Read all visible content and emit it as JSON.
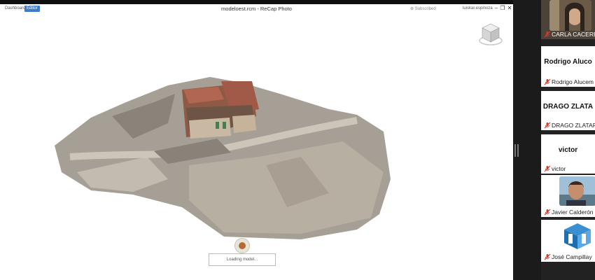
{
  "viewer": {
    "tabs": {
      "dashboard": "Dashboard",
      "editor": "Editor"
    },
    "title": "modeloest.rcm - ReCap Photo",
    "subscribed": "Subscribed",
    "user": "luiskar.espinoza",
    "loading": "Loading model..."
  },
  "participants": [
    {
      "display_name": "",
      "label": "CARLA CACERES",
      "muted": true,
      "has_video": true
    },
    {
      "display_name": "Rodrigo Aluco",
      "label": "Rodrigo Alucem",
      "muted": true,
      "has_video": false
    },
    {
      "display_name": "DRAGO ZLATA",
      "label": "DRAGO ZLATAR_",
      "muted": true,
      "has_video": false
    },
    {
      "display_name": "victor",
      "label": "victor",
      "muted": true,
      "has_video": false
    },
    {
      "display_name": "",
      "label": "Javier Calderón",
      "muted": true,
      "has_video": true
    },
    {
      "display_name": "",
      "label": "José Campillay",
      "muted": true,
      "has_video": true
    }
  ],
  "colors": {
    "muted_icon": "#d9382b",
    "editor_tab": "#3d7cc9"
  }
}
